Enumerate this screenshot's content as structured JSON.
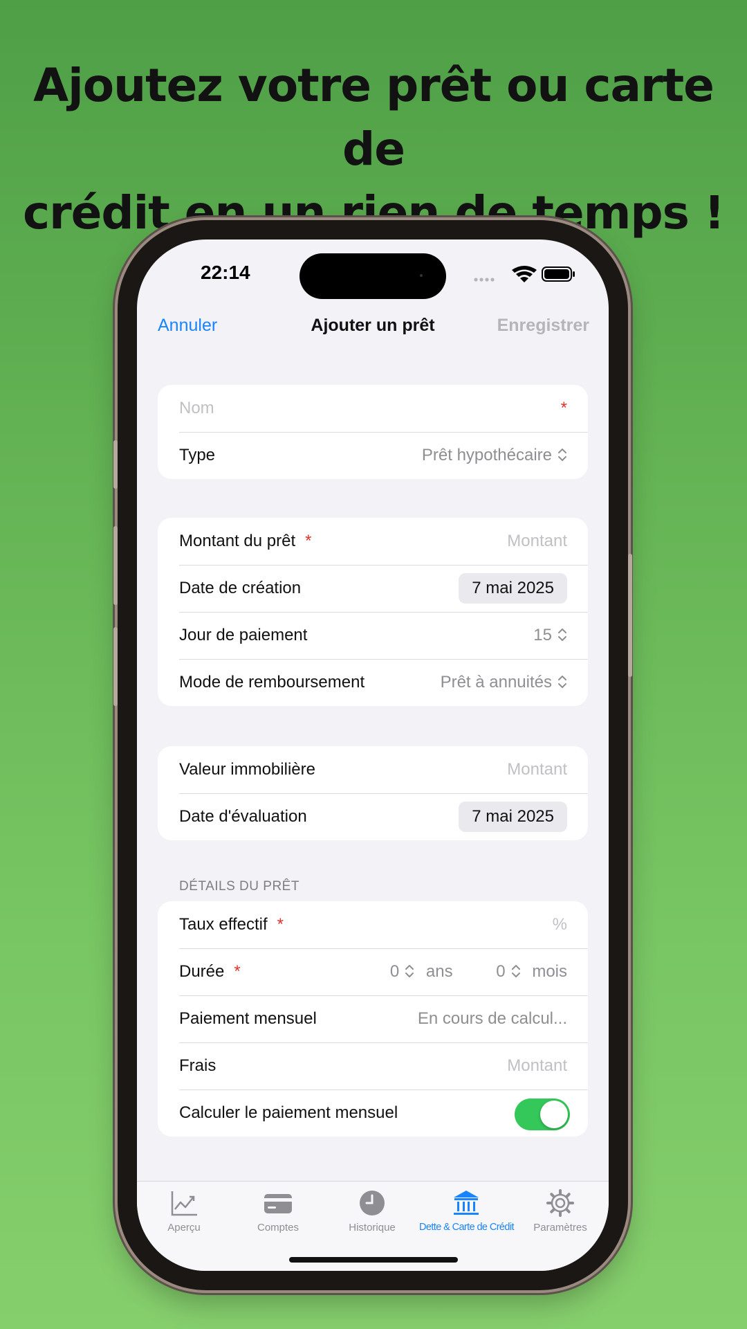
{
  "headline": {
    "line1": "Ajoutez votre prêt ou carte de",
    "line2": "crédit en un rien de temps !"
  },
  "status_bar": {
    "time": "22:14"
  },
  "nav": {
    "cancel": "Annuler",
    "title": "Ajouter un prêt",
    "save": "Enregistrer"
  },
  "section1": {
    "name_placeholder": "Nom",
    "required_mark": "*",
    "type_label": "Type",
    "type_value": "Prêt hypothécaire"
  },
  "section2": {
    "amount_label": "Montant du prêt",
    "amount_placeholder": "Montant",
    "creation_label": "Date de création",
    "creation_value": "7 mai 2025",
    "payment_day_label": "Jour de paiement",
    "payment_day_value": "15",
    "repayment_label": "Mode de remboursement",
    "repayment_value": "Prêt à annuités"
  },
  "section3": {
    "property_label": "Valeur immobilière",
    "property_placeholder": "Montant",
    "eval_label": "Date d'évaluation",
    "eval_value": "7 mai 2025"
  },
  "section4": {
    "header": "DÉTAILS DU PRÊT",
    "rate_label": "Taux effectif",
    "rate_placeholder": "%",
    "duration_label": "Durée",
    "years_value": "0",
    "years_unit": "ans",
    "months_value": "0",
    "months_unit": "mois",
    "monthly_label": "Paiement mensuel",
    "monthly_value": "En cours de calcul...",
    "fees_label": "Frais",
    "fees_placeholder": "Montant",
    "calc_label": "Calculer le paiement mensuel",
    "calc_on": true
  },
  "tabbar": {
    "tabs": [
      {
        "label": "Aperçu",
        "icon": "chart-line-icon"
      },
      {
        "label": "Comptes",
        "icon": "credit-card-icon"
      },
      {
        "label": "Historique",
        "icon": "clock-icon"
      },
      {
        "label": "Dette & Carte de Crédit",
        "icon": "bank-icon",
        "active": true
      },
      {
        "label": "Paramètres",
        "icon": "gear-icon"
      }
    ]
  },
  "colors": {
    "accent": "#1a84ff",
    "toggle_on": "#34c759",
    "required": "#e5312c"
  }
}
